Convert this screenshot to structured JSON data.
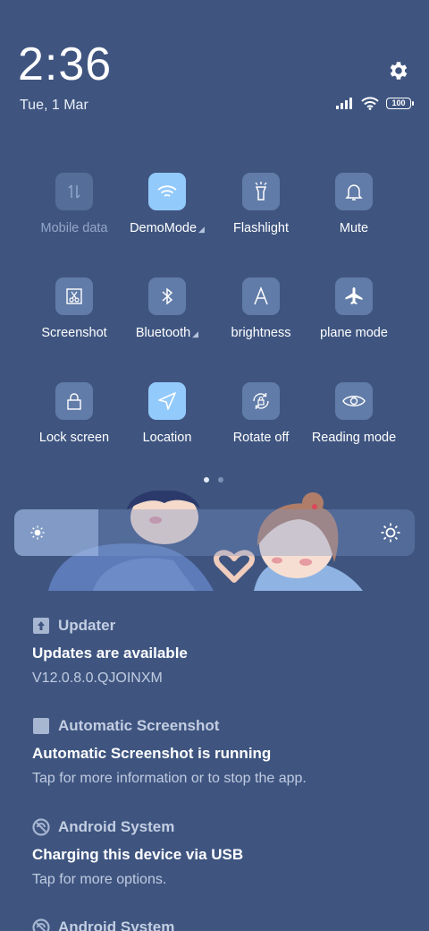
{
  "header": {
    "time": "2:36",
    "date": "Tue, 1 Mar",
    "battery": "100"
  },
  "tiles": [
    {
      "label": "Mobile data",
      "state": "off",
      "icon": "mobile-data-icon"
    },
    {
      "label": "DemoMode",
      "state": "on",
      "icon": "wifi-icon",
      "expandable": true
    },
    {
      "label": "Flashlight",
      "state": "idle",
      "icon": "flashlight-icon"
    },
    {
      "label": "Mute",
      "state": "idle",
      "icon": "bell-icon"
    },
    {
      "label": "Screenshot",
      "state": "idle",
      "icon": "screenshot-icon"
    },
    {
      "label": "Bluetooth",
      "state": "idle",
      "icon": "bluetooth-icon",
      "expandable": true
    },
    {
      "label": "brightness",
      "state": "idle",
      "icon": "auto-brightness-icon"
    },
    {
      "label": "plane mode",
      "state": "idle",
      "icon": "airplane-icon"
    },
    {
      "label": "Lock screen",
      "state": "idle",
      "icon": "lock-icon"
    },
    {
      "label": "Location",
      "state": "on",
      "icon": "location-icon"
    },
    {
      "label": "Rotate off",
      "state": "idle",
      "icon": "rotate-lock-icon"
    },
    {
      "label": "Reading mode",
      "state": "idle",
      "icon": "eye-icon"
    }
  ],
  "pager": {
    "pages": 2,
    "current": 1
  },
  "brightness": {
    "level": 0.21
  },
  "notifications": [
    {
      "app": "Updater",
      "title": "Updates are available",
      "text": "V12.0.8.0.QJOINXM",
      "icon": "updater-icon"
    },
    {
      "app": "Automatic Screenshot",
      "title": "Automatic Screenshot is running",
      "text": "Tap for more information or to stop the app.",
      "icon": "app-square-icon"
    },
    {
      "app": "Android System",
      "title": "Charging this device via USB",
      "text": "Tap for more options.",
      "icon": "android-system-icon"
    },
    {
      "app": "Android System",
      "icon": "android-system-icon"
    }
  ],
  "colors": {
    "background": "#3f5580",
    "active_tile": "#93cafc"
  }
}
